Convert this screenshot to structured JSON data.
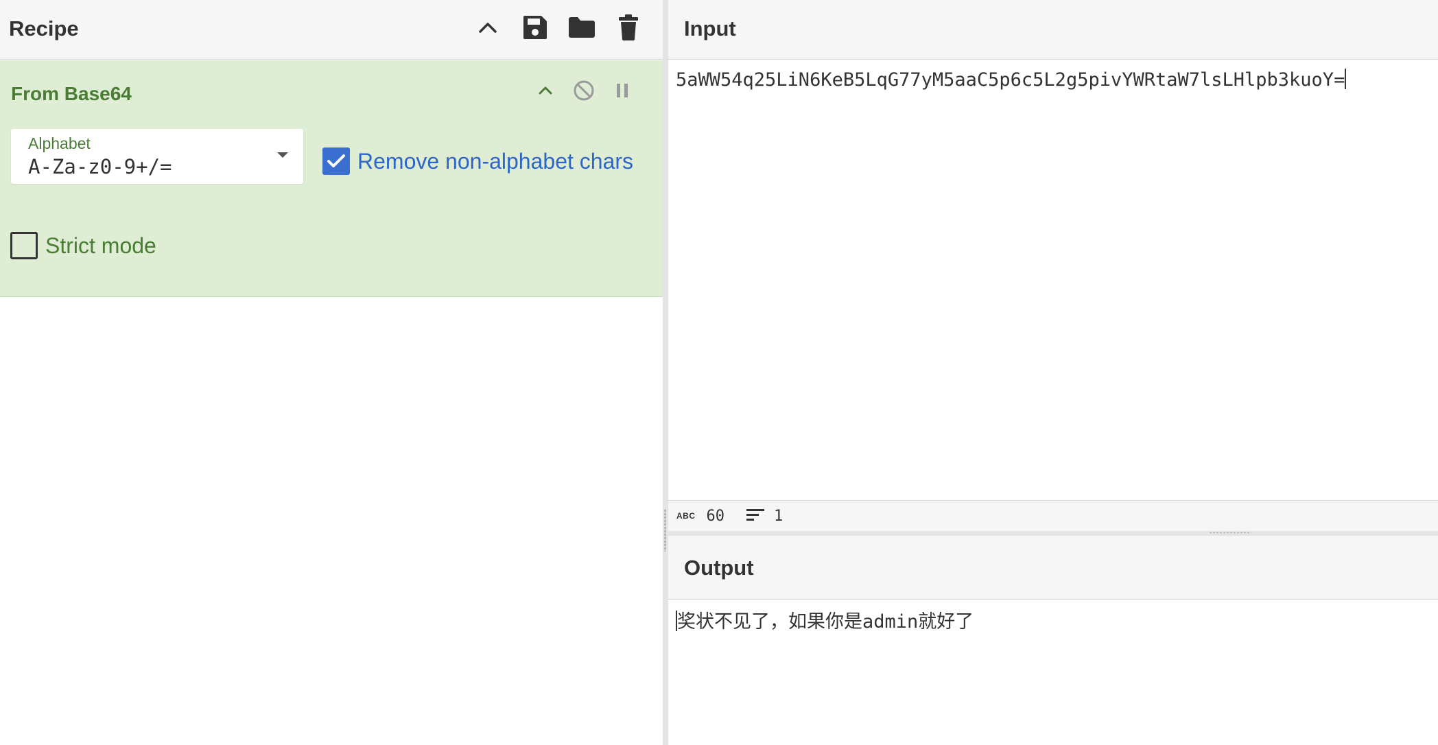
{
  "recipe": {
    "title": "Recipe",
    "header_icons": [
      "chevron-up-icon",
      "save-icon",
      "folder-icon",
      "trash-icon"
    ],
    "operation": {
      "name": "From Base64",
      "icons": [
        "chevron-up-icon",
        "disable-icon",
        "pause-icon"
      ],
      "alphabet": {
        "label": "Alphabet",
        "value": "A-Za-z0-9+/="
      },
      "remove_non_alphabet": {
        "label": "Remove non-alphabet chars",
        "checked": true
      },
      "strict_mode": {
        "label": "Strict mode",
        "checked": false
      }
    }
  },
  "input": {
    "title": "Input",
    "text": "5aWW54q25LiN6KeB5LqG77yM5aaC5p6c5L2g5pivYWRtaW7lsLHlpb3kuoY=",
    "status": {
      "length_icon": "ABC",
      "length": "60",
      "lines": "1"
    }
  },
  "output": {
    "title": "Output",
    "text": "奖状不见了，如果你是admin就好了"
  },
  "colors": {
    "operation_bg": "#dfedd5",
    "operation_text": "#4a7c35",
    "checkbox_on": "#3a6fd0",
    "link_blue": "#2c66c8"
  }
}
